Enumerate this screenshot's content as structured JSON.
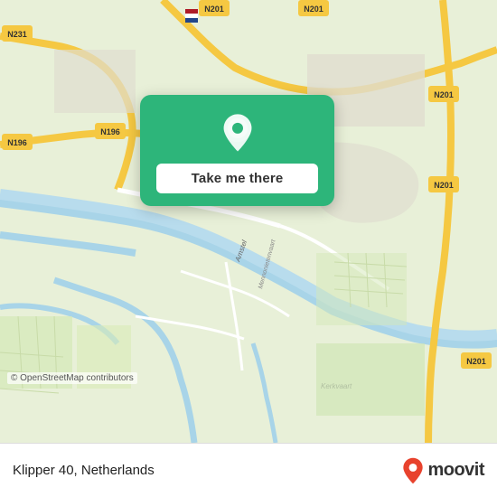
{
  "map": {
    "osm_credit": "© OpenStreetMap contributors"
  },
  "tooltip": {
    "button_label": "Take me there"
  },
  "bottom_bar": {
    "location_text": "Klipper 40, Netherlands",
    "logo_text": "moovit"
  }
}
